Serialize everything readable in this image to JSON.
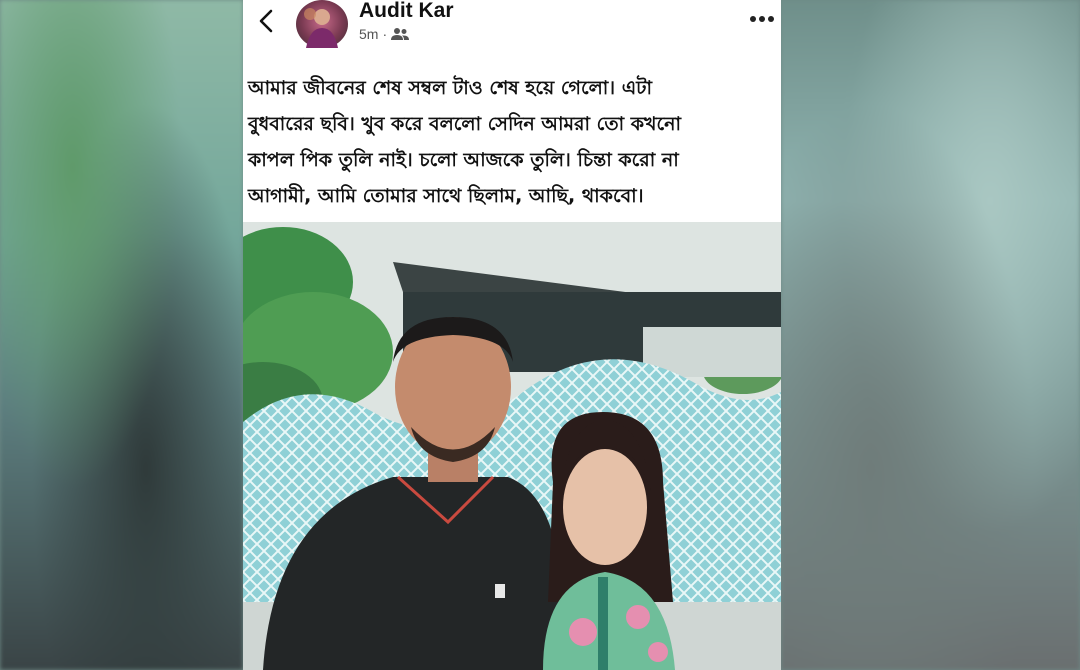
{
  "post": {
    "author": "Audit Kar",
    "time": "5m",
    "separator": "·",
    "audience_icon": "friends-icon",
    "caption_lines": [
      "আমার জীবনের শেষ সম্বল টাও শেষ হয়ে গেলো। এটা",
      "বুধবারের ছবি। খুব করে বললো সেদিন আমরা তো কখনো",
      "কাপল পিক তুলি নাই। চলো আজকে তুলি।  চিন্তা করো না",
      "আগামী, আমি তোমার সাথে ছিলাম, আছি, থাকবো।"
    ]
  },
  "icons": [
    "back-arrow-icon",
    "avatar",
    "friends-icon",
    "more-options-icon"
  ],
  "colors": {
    "card_bg": "#ffffff",
    "text": "#111111",
    "meta": "#555555"
  }
}
